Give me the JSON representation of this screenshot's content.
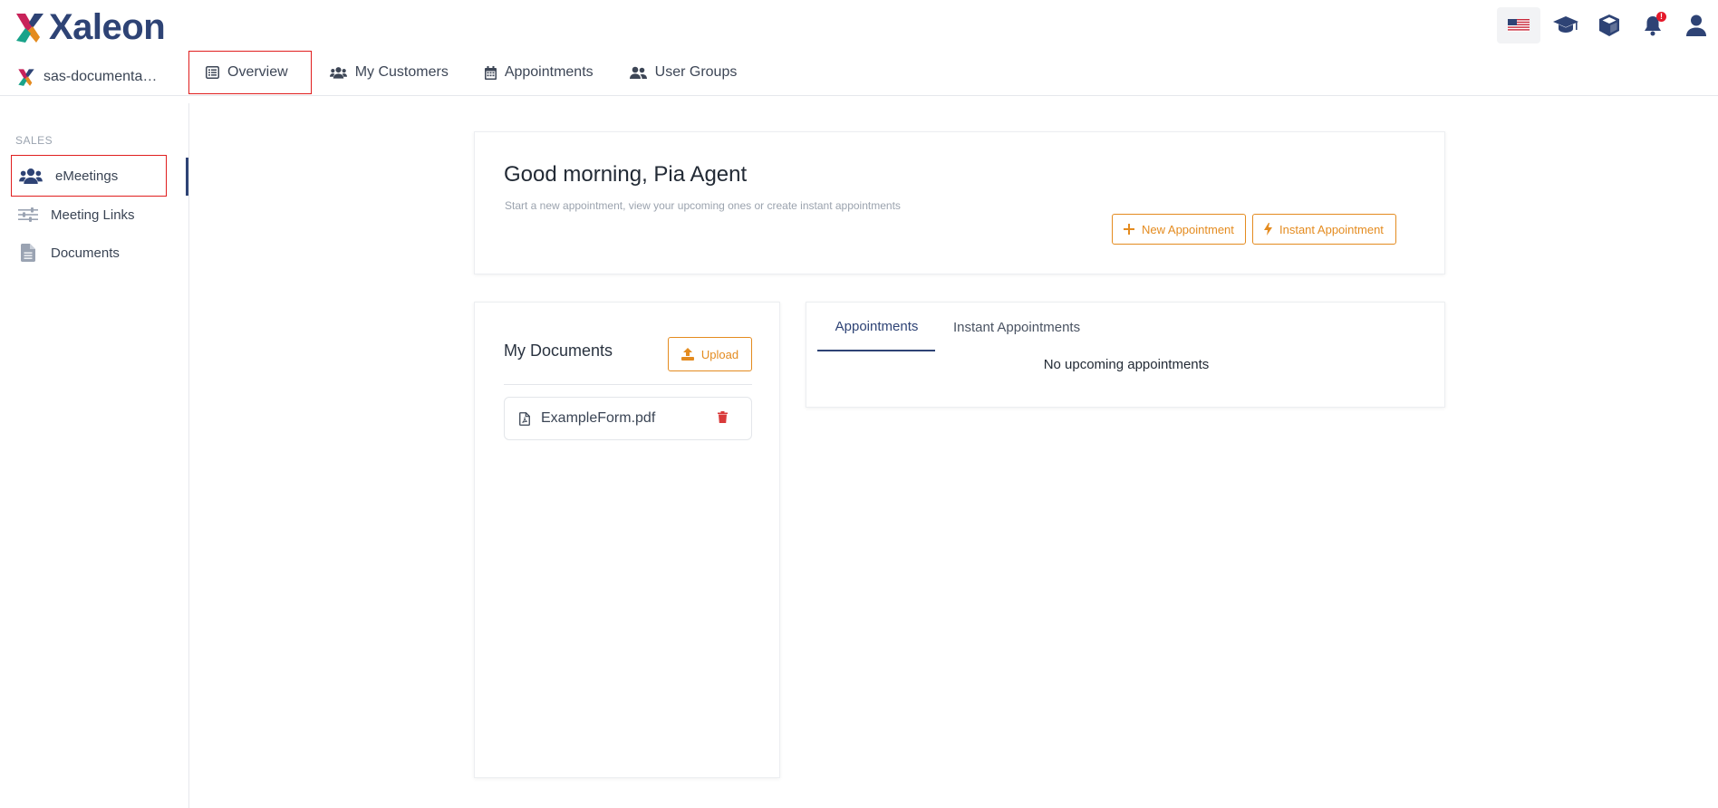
{
  "brand": {
    "name": "Xaleon"
  },
  "tenant": {
    "name": "sas-documentati..."
  },
  "nav": [
    {
      "label": "Overview",
      "icon": "list-icon",
      "active": true
    },
    {
      "label": "My Customers",
      "icon": "users-icon"
    },
    {
      "label": "Appointments",
      "icon": "calendar-icon"
    },
    {
      "label": "User Groups",
      "icon": "user-group-icon"
    }
  ],
  "top_icons": [
    "us-flag-icon",
    "graduation-cap-icon",
    "cube-icon",
    "bell-icon",
    "user-icon"
  ],
  "notification_badge": "!",
  "sidebar": {
    "section": "SALES",
    "items": [
      {
        "label": "eMeetings",
        "icon": "users-icon",
        "active": true
      },
      {
        "label": "Meeting Links",
        "icon": "sliders-icon"
      },
      {
        "label": "Documents",
        "icon": "file-icon"
      }
    ]
  },
  "greeting": {
    "title": "Good morning, Pia Agent",
    "subtitle": "Start a new appointment, view your upcoming ones or create instant appointments",
    "new_button": "New Appointment",
    "instant_button": "Instant Appointment"
  },
  "documents": {
    "title": "My Documents",
    "upload_button": "Upload",
    "files": [
      {
        "name": "ExampleForm.pdf"
      }
    ]
  },
  "appointments": {
    "tabs": [
      {
        "label": "Appointments",
        "active": true
      },
      {
        "label": "Instant Appointments"
      }
    ],
    "empty_message": "No upcoming appointments"
  },
  "colors": {
    "brand_navy": "#2e4375",
    "accent_orange": "#e48b1f",
    "danger_red": "#e5192a",
    "highlight_box": "#e01e1e"
  }
}
